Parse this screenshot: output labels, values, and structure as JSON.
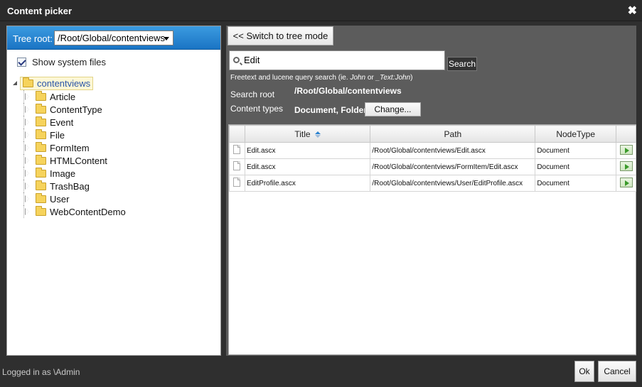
{
  "dialog": {
    "title": "Content picker"
  },
  "background": {
    "status": "Logged in as \\Admin"
  },
  "tree": {
    "root_label": "Tree root:",
    "root_value": "/Root/Global/contentviews",
    "show_system_files": "Show system files",
    "root_node": "contentviews",
    "children": [
      "Article",
      "ContentType",
      "Event",
      "File",
      "FormItem",
      "HTMLContent",
      "Image",
      "TrashBag",
      "User",
      "WebContentDemo"
    ]
  },
  "search": {
    "switch_label": "<< Switch to tree mode",
    "query": "Edit",
    "button": "Search",
    "hint_prefix": "Freetext and lucene query search (ie. ",
    "hint_ex1": "John",
    "hint_mid": " or ",
    "hint_ex2": "_Text:John",
    "hint_suffix": ")",
    "root_label": "Search root",
    "root_value": "/Root/Global/contentviews",
    "types_label": "Content types",
    "types_value": "Document, Folder",
    "change_button": "Change..."
  },
  "results": {
    "columns": [
      "Title",
      "Path",
      "NodeType"
    ],
    "rows": [
      {
        "title": "Edit.ascx",
        "path": "/Root/Global/contentviews/Edit.ascx",
        "type": "Document"
      },
      {
        "title": "Edit.ascx",
        "path": "/Root/Global/contentviews/FormItem/Edit.ascx",
        "type": "Document"
      },
      {
        "title": "EditProfile.ascx",
        "path": "/Root/Global/contentviews/User/EditProfile.ascx",
        "type": "Document"
      }
    ]
  },
  "footer": {
    "ok": "Ok",
    "cancel": "Cancel"
  }
}
